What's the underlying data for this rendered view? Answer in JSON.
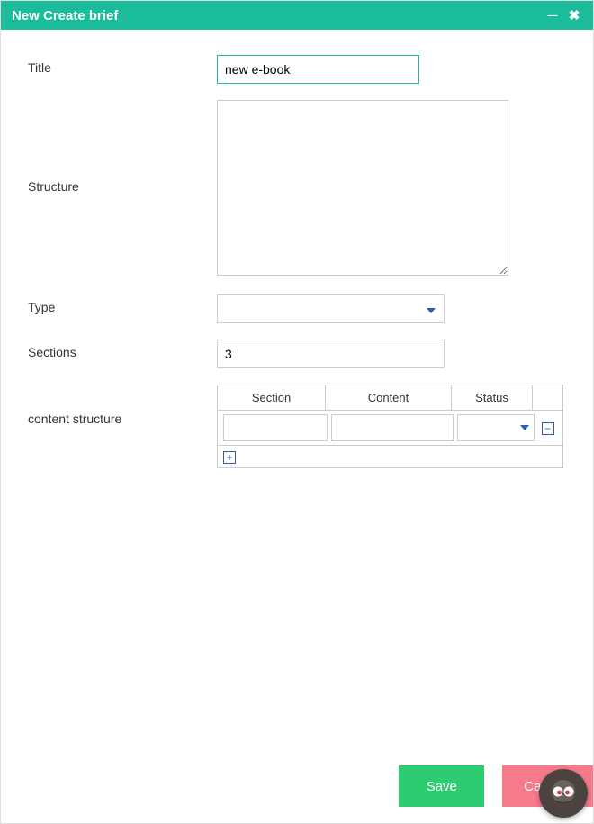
{
  "window": {
    "title": "New Create brief"
  },
  "fields": {
    "title_label": "Title",
    "title_value": "new e-book",
    "structure_label": "Structure",
    "structure_value": "",
    "type_label": "Type",
    "type_value": "",
    "sections_label": "Sections",
    "sections_value": "3",
    "content_structure_label": "content structure"
  },
  "grid": {
    "headers": {
      "section": "Section",
      "content": "Content",
      "status": "Status"
    },
    "rows": [
      {
        "section": "",
        "content": "",
        "status": ""
      }
    ]
  },
  "buttons": {
    "save": "Save",
    "cancel": "Cancel"
  },
  "colors": {
    "accent": "#1bbc9b",
    "save": "#2ecc71",
    "cancel": "#f77a8b",
    "link_blue": "#2e5db0"
  }
}
